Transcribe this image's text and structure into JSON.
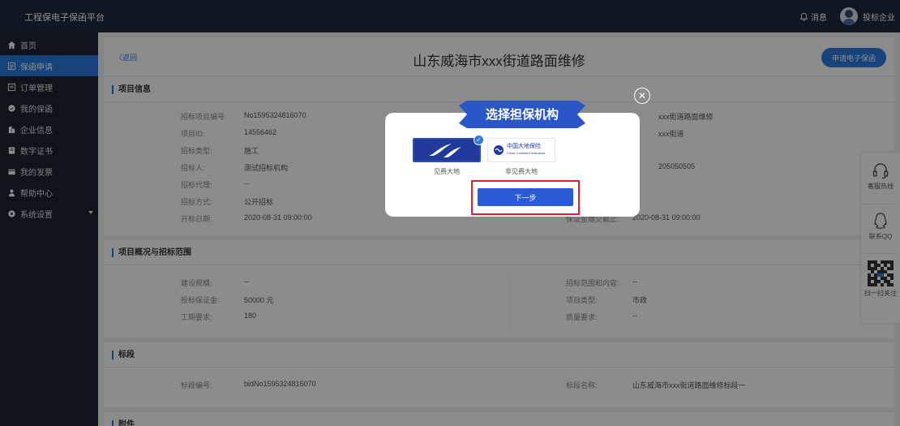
{
  "topbar": {
    "brand": "工程保电子保函平台",
    "message_label": "消息",
    "user_label": "投标企业"
  },
  "sidebar": {
    "items": [
      {
        "label": "首页",
        "icon": "home-icon"
      },
      {
        "label": "保函申请",
        "icon": "form-icon",
        "active": true
      },
      {
        "label": "订单管理",
        "icon": "order-icon"
      },
      {
        "label": "我的保函",
        "icon": "shield-icon"
      },
      {
        "label": "企业信息",
        "icon": "building-icon"
      },
      {
        "label": "数字证书",
        "icon": "certificate-icon"
      },
      {
        "label": "我的发票",
        "icon": "invoice-icon"
      },
      {
        "label": "帮助中心",
        "icon": "help-icon"
      },
      {
        "label": "系统设置",
        "icon": "settings-icon",
        "has_submenu": true
      }
    ]
  },
  "header": {
    "back": "〈返回",
    "title": "山东威海市xxx街道路面维修",
    "apply_button": "申请电子保函"
  },
  "project_info": {
    "section_title": "项目信息",
    "left_fields": [
      {
        "label": "招标项目编号:",
        "value": "No1595324816070"
      },
      {
        "label": "项目ID:",
        "value": "14556462"
      },
      {
        "label": "招标类型:",
        "value": "施工"
      },
      {
        "label": "招标人:",
        "value": "测试招标机构"
      },
      {
        "label": "招标代理:",
        "value": "--"
      },
      {
        "label": "招标方式:",
        "value": "公开招标"
      },
      {
        "label": "开标日期:",
        "value": "2020-08-31 09:00:00"
      }
    ],
    "right_fragments": [
      "xxx街道路面维修",
      "xxx街道",
      "205050505"
    ],
    "deposit_deadline": {
      "label": "保证金缴交截止:",
      "value": "2020-08-31 09:00:00"
    }
  },
  "overview": {
    "section_title": "项目概况与招标范围",
    "left_fields": [
      {
        "label": "建设规模:",
        "value": "--"
      },
      {
        "label": "投标保证金:",
        "value": "50000 元"
      },
      {
        "label": "工期要求:",
        "value": "180"
      }
    ],
    "right_fields": [
      {
        "label": "招标范围和内容:",
        "value": "--"
      },
      {
        "label": "项目类型:",
        "value": "市政"
      },
      {
        "label": "质量要求:",
        "value": "--"
      }
    ]
  },
  "bid_section": {
    "section_title": "标段",
    "number": {
      "label": "标段编号:",
      "value": "bidNo1595324816070"
    },
    "name": {
      "label": "标段名称:",
      "value": "山东威海市xxx街道路面维修标段一"
    }
  },
  "attachments": {
    "section_title": "附件"
  },
  "floating": {
    "hotline": "客服热线",
    "qq": "联系QQ",
    "scan": "扫一扫关注"
  },
  "modal": {
    "title": "选择担保机构",
    "insurers": [
      {
        "name": "见费大地",
        "selected": true
      },
      {
        "name": "非见费大地",
        "logo_cn": "中国大地保险",
        "logo_en": "China Continent Insurance",
        "selected": false
      }
    ],
    "next_button": "下一步"
  },
  "colors": {
    "accent": "#2a7bde",
    "sidebar_bg": "#1f2331",
    "topbar_bg": "#1e2a3f",
    "highlight": "#e0202a"
  }
}
